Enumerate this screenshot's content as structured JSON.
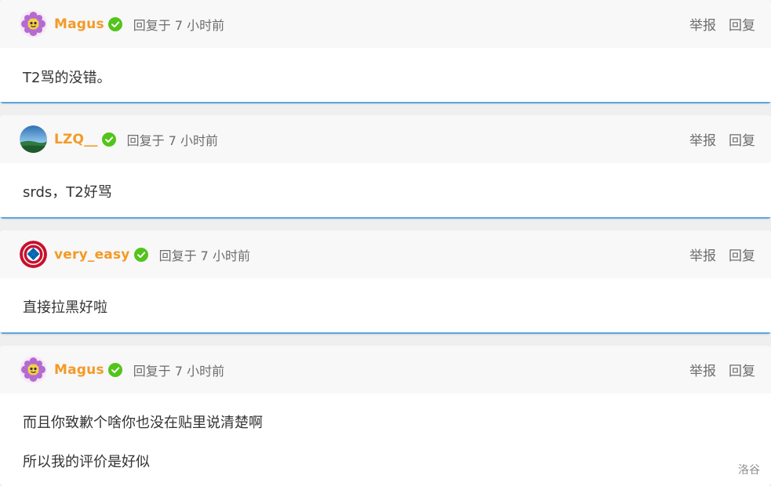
{
  "replies": [
    {
      "username": "Magus",
      "avatar": "purple-flower-icon",
      "time": "回复于 7 小时前",
      "report": "举报",
      "reply": "回复",
      "content": [
        "T2骂的没错。"
      ]
    },
    {
      "username": "LZQ__",
      "avatar": "sky-landscape-icon",
      "time": "回复于 7 小时前",
      "report": "举报",
      "reply": "回复",
      "content": [
        "srds，T2好骂"
      ]
    },
    {
      "username": "very_easy",
      "avatar": "bayern-munich-crest-icon",
      "time": "回复于 7 小时前",
      "report": "举报",
      "reply": "回复",
      "content": [
        "直接拉黑好啦"
      ]
    },
    {
      "username": "Magus",
      "avatar": "purple-flower-icon",
      "time": "回复于 7 小时前",
      "report": "举报",
      "reply": "回复",
      "content": [
        "而且你致歉个啥你也没在贴里说清楚啊",
        "所以我的评价是好似"
      ]
    }
  ],
  "colors": {
    "username": "#f39a26",
    "verified": "#52c41a",
    "accent": "#5aa4e0"
  },
  "watermark": "洛谷"
}
